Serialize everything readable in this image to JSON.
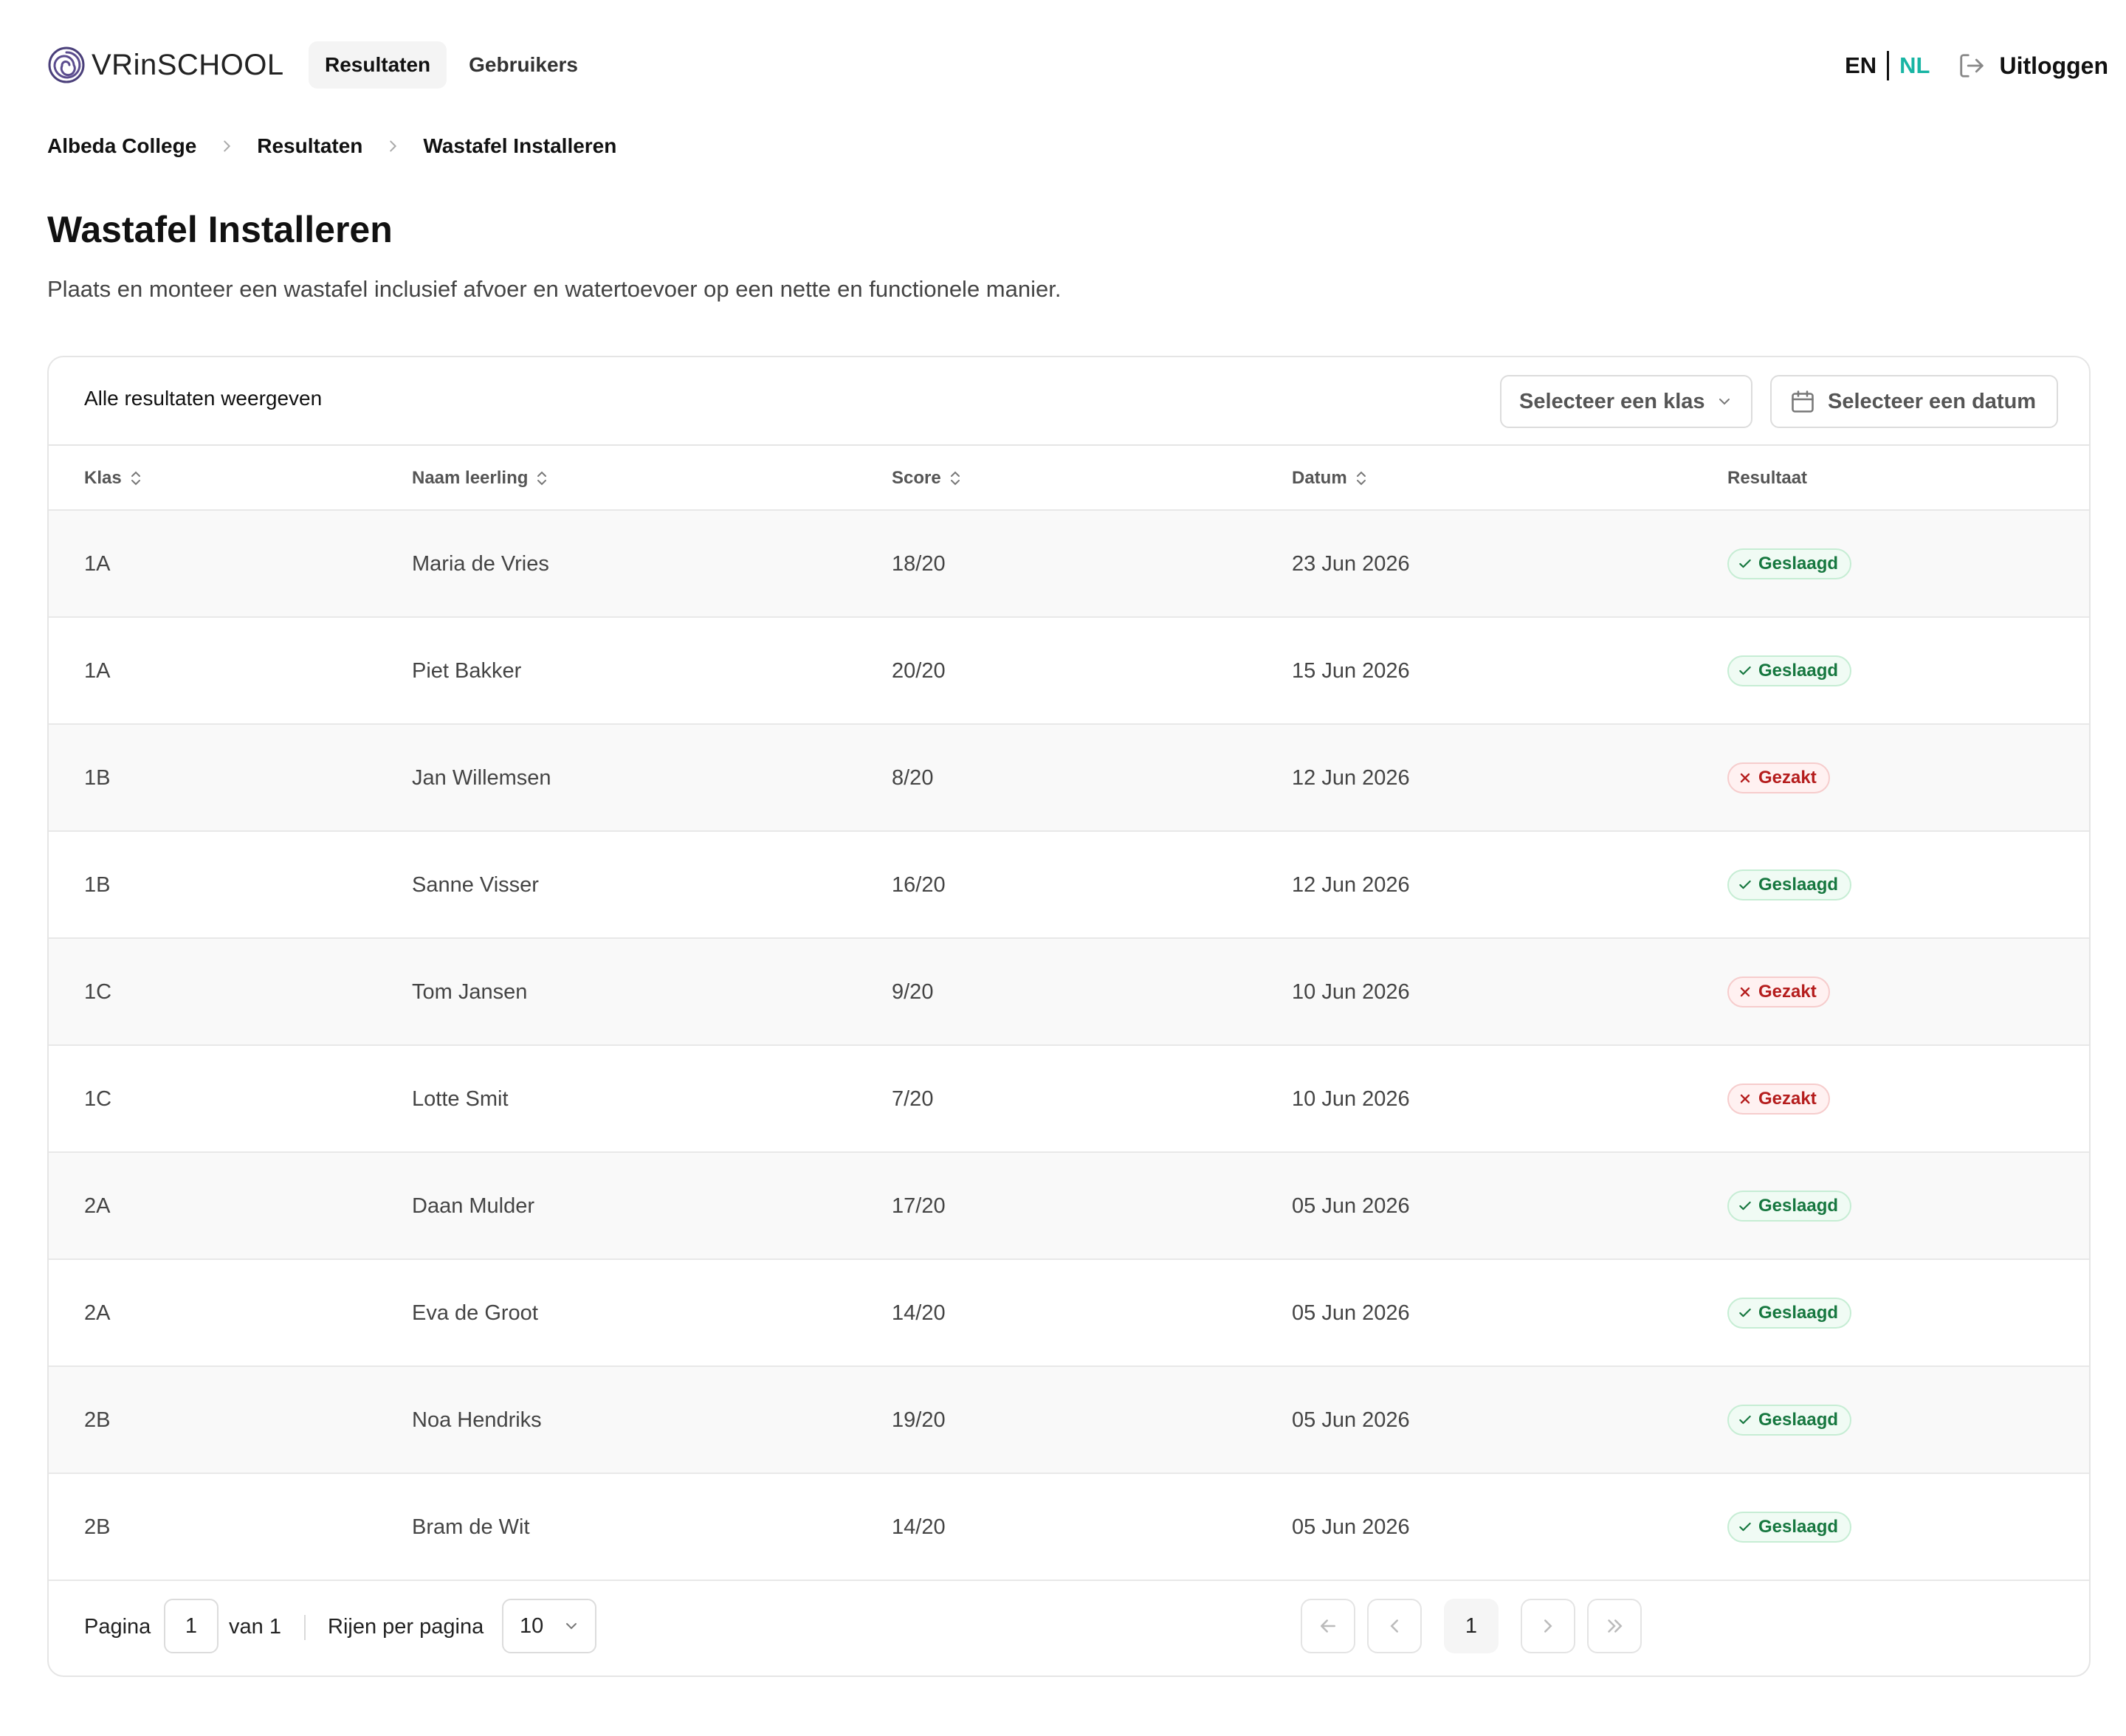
{
  "header": {
    "logo_text": "VRinSCHOOL",
    "nav": [
      {
        "label": "Resultaten",
        "active": true
      },
      {
        "label": "Gebruikers",
        "active": false
      }
    ],
    "lang_en": "EN",
    "lang_nl": "NL",
    "active_lang": "NL",
    "logout_label": "Uitloggen",
    "accent_color": "#19b5a4"
  },
  "breadcrumb": [
    "Albeda College",
    "Resultaten",
    "Wastafel Installeren"
  ],
  "page": {
    "title": "Wastafel Installeren",
    "description": "Plaats en monteer een wastafel inclusief afvoer en watertoevoer op een nette en functionele manier."
  },
  "toolbar": {
    "label": "Alle resultaten weergeven",
    "class_select_placeholder": "Selecteer een klas",
    "date_select_placeholder": "Selecteer een datum"
  },
  "table": {
    "columns": [
      "Klas",
      "Naam leerling",
      "Score",
      "Datum",
      "Resultaat"
    ],
    "rows": [
      {
        "klas": "1A",
        "naam": "Maria de Vries",
        "score": "18/20",
        "datum": "23 Jun 2026",
        "resultaat": "Geslaagd",
        "status": "pass"
      },
      {
        "klas": "1A",
        "naam": "Piet Bakker",
        "score": "20/20",
        "datum": "15 Jun 2026",
        "resultaat": "Geslaagd",
        "status": "pass"
      },
      {
        "klas": "1B",
        "naam": "Jan Willemsen",
        "score": "8/20",
        "datum": "12 Jun 2026",
        "resultaat": "Gezakt",
        "status": "fail"
      },
      {
        "klas": "1B",
        "naam": "Sanne Visser",
        "score": "16/20",
        "datum": "12 Jun 2026",
        "resultaat": "Geslaagd",
        "status": "pass"
      },
      {
        "klas": "1C",
        "naam": "Tom Jansen",
        "score": "9/20",
        "datum": "10 Jun 2026",
        "resultaat": "Gezakt",
        "status": "fail"
      },
      {
        "klas": "1C",
        "naam": "Lotte Smit",
        "score": "7/20",
        "datum": "10 Jun 2026",
        "resultaat": "Gezakt",
        "status": "fail"
      },
      {
        "klas": "2A",
        "naam": "Daan Mulder",
        "score": "17/20",
        "datum": "05 Jun 2026",
        "resultaat": "Geslaagd",
        "status": "pass"
      },
      {
        "klas": "2A",
        "naam": "Eva de Groot",
        "score": "14/20",
        "datum": "05 Jun 2026",
        "resultaat": "Geslaagd",
        "status": "pass"
      },
      {
        "klas": "2B",
        "naam": "Noa Hendriks",
        "score": "19/20",
        "datum": "05 Jun 2026",
        "resultaat": "Geslaagd",
        "status": "pass"
      },
      {
        "klas": "2B",
        "naam": "Bram de Wit",
        "score": "14/20",
        "datum": "05 Jun 2026",
        "resultaat": "Geslaagd",
        "status": "pass"
      }
    ]
  },
  "pagination": {
    "page_label": "Pagina",
    "current_page": "1",
    "of_label": "van 1",
    "rows_label": "Rijen per pagina",
    "rows_per_page": "10",
    "page_number": "1"
  },
  "icons": [
    "logo-spiral-icon",
    "logout-icon",
    "chevron-right-icon",
    "chevron-down-icon",
    "calendar-icon",
    "sort-icon",
    "check-icon",
    "x-icon",
    "arrow-left-icon",
    "chevron-left-icon",
    "chevron-right-icon",
    "chevrons-right-icon"
  ]
}
